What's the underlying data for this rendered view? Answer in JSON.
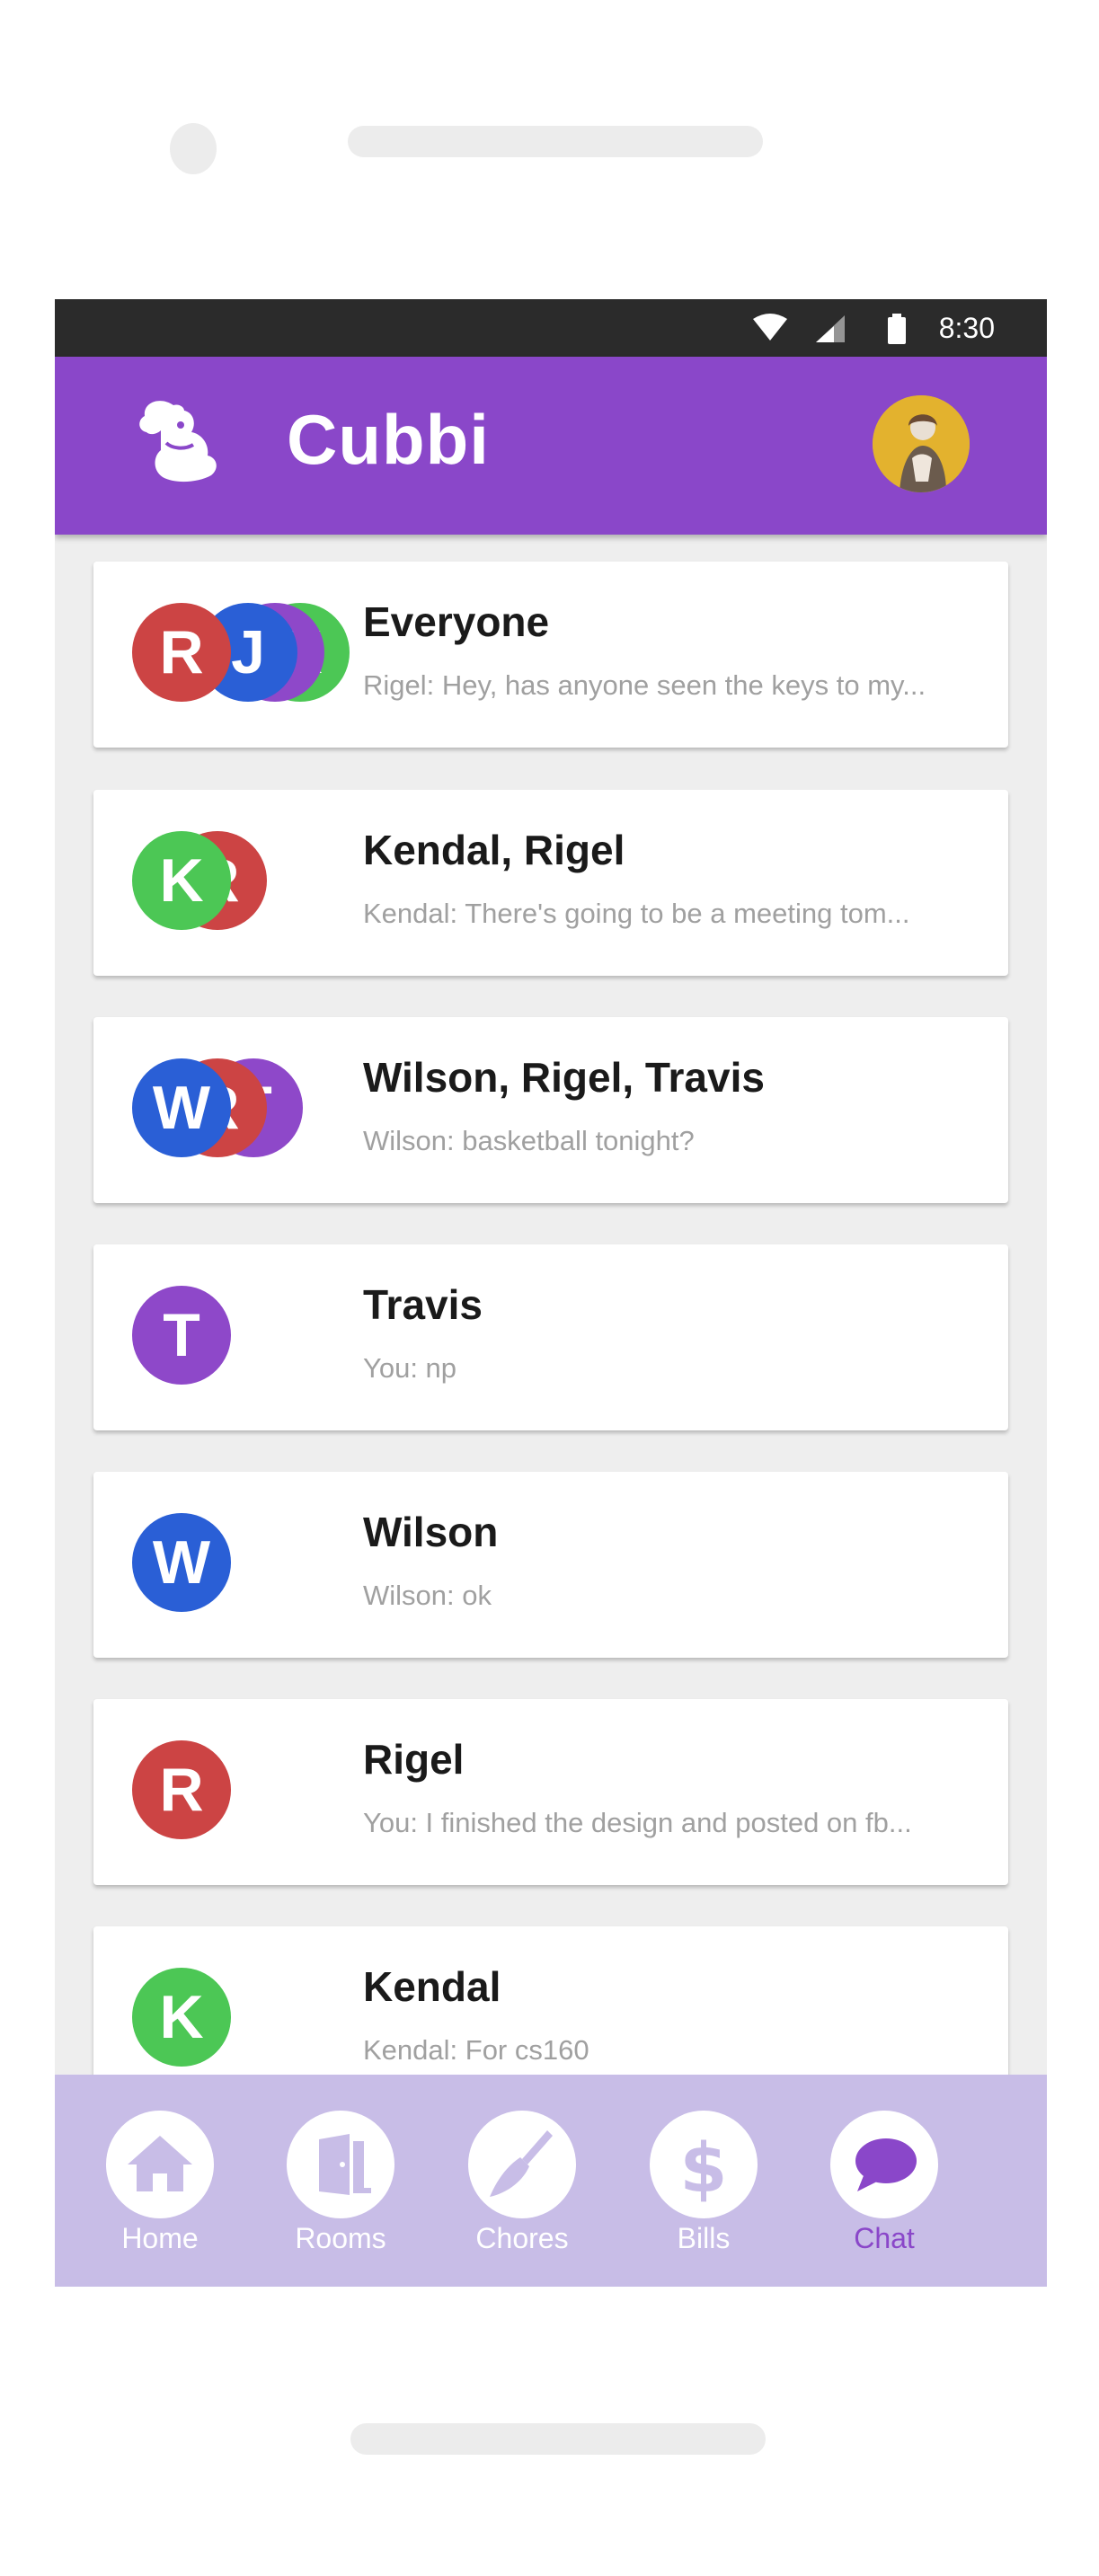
{
  "status_bar": {
    "time": "8:30"
  },
  "app_bar": {
    "title": "Cubbi"
  },
  "chats": [
    {
      "name": "Everyone",
      "preview": "Rigel: Hey, has anyone seen the keys to my...",
      "avatars": [
        {
          "letter": "R",
          "color": "#cc4444"
        },
        {
          "letter": "J",
          "color": "#2a5fd6"
        },
        {
          "letter": "T",
          "color": "#8e48c9"
        },
        {
          "letter": "K",
          "color": "#4cc755"
        }
      ]
    },
    {
      "name": "Kendal, Rigel",
      "preview": "Kendal: There's going to be a meeting tom...",
      "avatars": [
        {
          "letter": "K",
          "color": "#4cc755"
        },
        {
          "letter": "R",
          "color": "#cc4444"
        }
      ]
    },
    {
      "name": "Wilson, Rigel, Travis",
      "preview": "Wilson: basketball tonight?",
      "avatars": [
        {
          "letter": "W",
          "color": "#2a5fd6"
        },
        {
          "letter": "R",
          "color": "#cc4444"
        },
        {
          "letter": "T",
          "color": "#8e48c9"
        }
      ]
    },
    {
      "name": "Travis",
      "preview": "You: np",
      "avatars": [
        {
          "letter": "T",
          "color": "#8e48c9"
        }
      ]
    },
    {
      "name": "Wilson",
      "preview": "Wilson: ok",
      "avatars": [
        {
          "letter": "W",
          "color": "#2a5fd6"
        }
      ]
    },
    {
      "name": "Rigel",
      "preview": "You: I finished the design and posted on fb...",
      "avatars": [
        {
          "letter": "R",
          "color": "#cc4444"
        }
      ]
    },
    {
      "name": "Kendal",
      "preview": "Kendal: For cs160",
      "avatars": [
        {
          "letter": "K",
          "color": "#4cc755"
        }
      ]
    }
  ],
  "nav": {
    "home": "Home",
    "rooms": "Rooms",
    "chores": "Chores",
    "bills": "Bills",
    "chat": "Chat",
    "active": "Chat"
  },
  "colors": {
    "brand": "#8a47c9",
    "nav_bg": "#c8bde7",
    "icon": "#c8bde7"
  }
}
